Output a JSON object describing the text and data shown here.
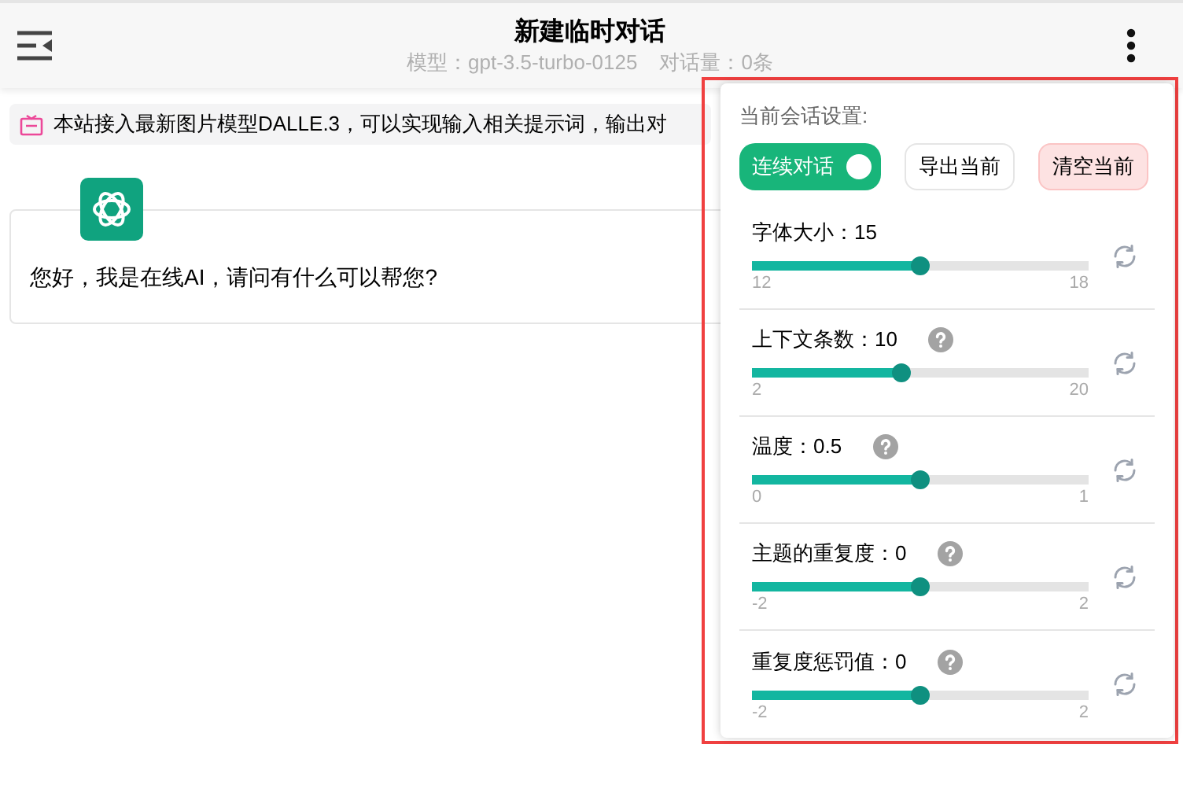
{
  "header": {
    "title": "新建临时对话",
    "model": "模型：gpt-3.5-turbo-0125",
    "count": "对话量：0条"
  },
  "notice": "本站接入最新图片模型DALLE.3，可以实现输入相关提示词，输出对",
  "message": {
    "text": "您好，我是在线AI，请问有什么可以帮您?"
  },
  "settings": {
    "title": "当前会话设置:",
    "toggle": {
      "label": "连续对话",
      "on": true
    },
    "buttons": [
      {
        "label": "导出当前",
        "kind": "plain"
      },
      {
        "label": "清空当前",
        "kind": "danger"
      }
    ],
    "sliders": [
      {
        "label": "字体大小：",
        "value": "15",
        "help": false,
        "level": 0.5,
        "min": "12",
        "max": "18"
      },
      {
        "label": "上下文条数：",
        "value": "10",
        "help": true,
        "level": 0.444,
        "min": "2",
        "max": "20"
      },
      {
        "label": "温度：",
        "value": "0.5",
        "help": true,
        "level": 0.5,
        "min": "0",
        "max": "1"
      },
      {
        "label": "主题的重复度：",
        "value": "0",
        "help": true,
        "level": 0.5,
        "min": "-2",
        "max": "2"
      },
      {
        "label": "重复度惩罚值：",
        "value": "0",
        "help": true,
        "level": 0.5,
        "min": "-2",
        "max": "2"
      }
    ]
  }
}
